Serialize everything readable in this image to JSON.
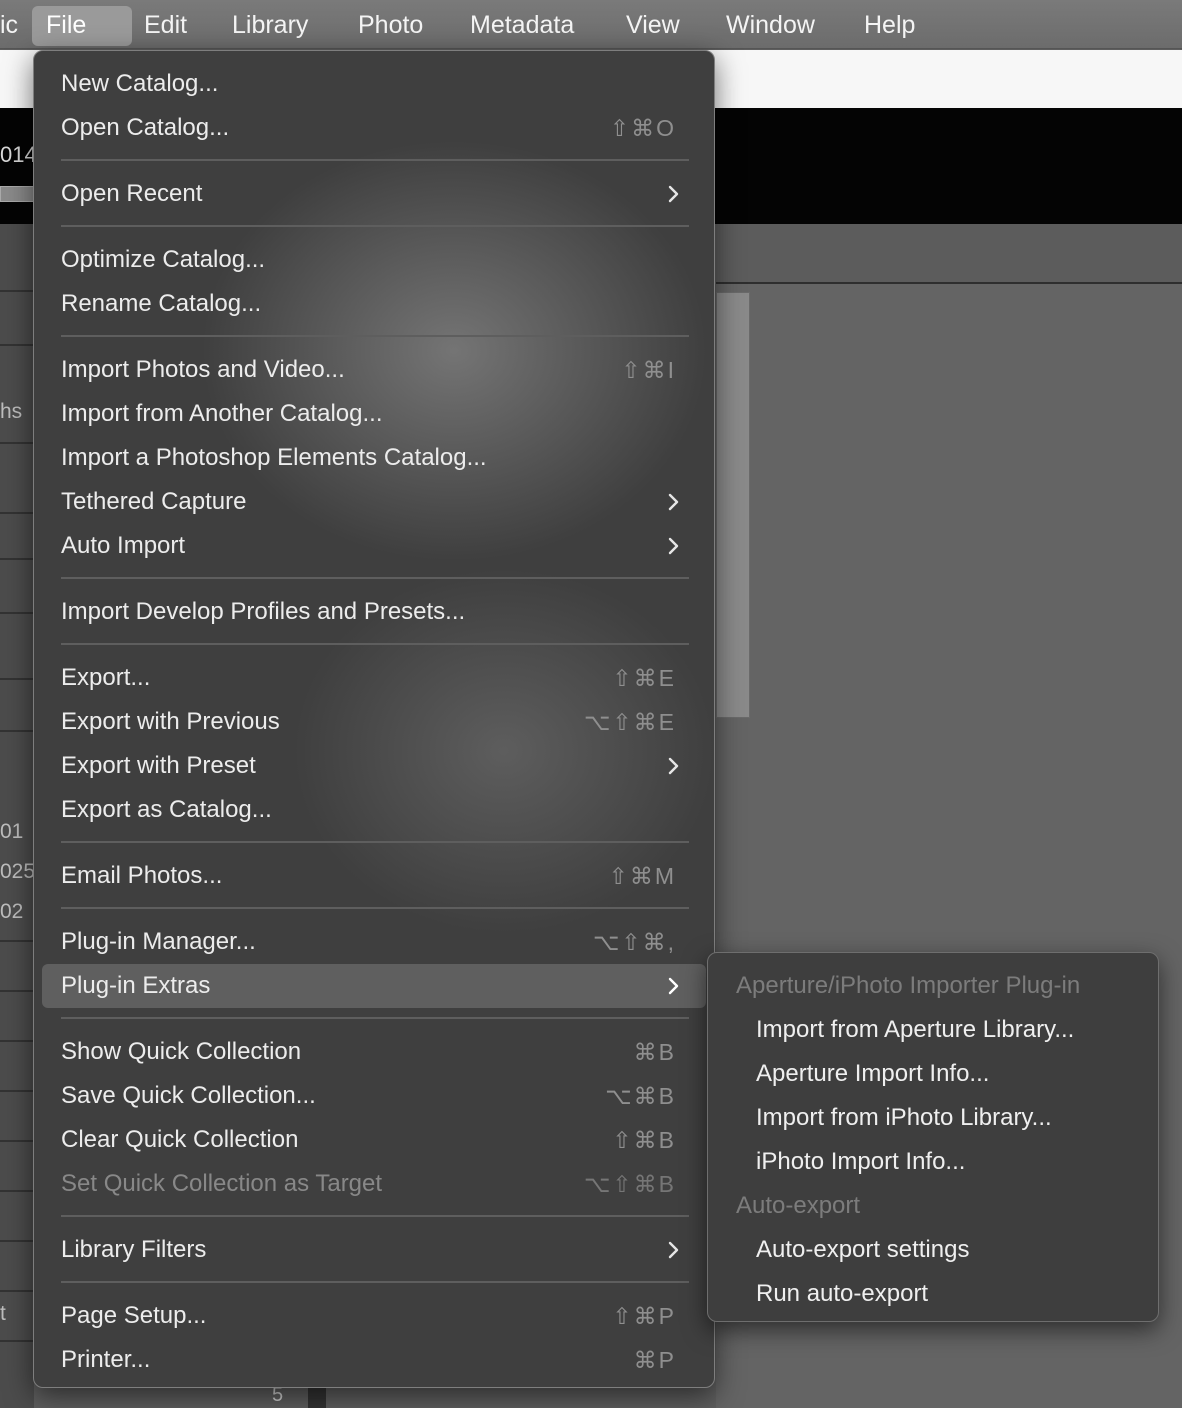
{
  "menubar": {
    "app_fragment": "ic",
    "items": [
      "File",
      "Edit",
      "Library",
      "Photo",
      "Metadata",
      "View",
      "Window",
      "Help"
    ]
  },
  "background": {
    "path_fragment": "014/",
    "left_fragments": [
      "hs",
      "01",
      "025-",
      "02",
      "t",
      "5"
    ]
  },
  "file_menu": {
    "items": [
      {
        "label": "New Catalog...",
        "shortcut": ""
      },
      {
        "label": "Open Catalog...",
        "shortcut": "⇧⌘O"
      },
      {
        "label": "Open Recent",
        "submenu": true
      },
      {
        "label": "Optimize Catalog...",
        "shortcut": ""
      },
      {
        "label": "Rename Catalog...",
        "shortcut": ""
      },
      {
        "label": "Import Photos and Video...",
        "shortcut": "⇧⌘I"
      },
      {
        "label": "Import from Another Catalog...",
        "shortcut": ""
      },
      {
        "label": "Import a Photoshop Elements Catalog...",
        "shortcut": ""
      },
      {
        "label": "Tethered Capture",
        "submenu": true
      },
      {
        "label": "Auto Import",
        "submenu": true
      },
      {
        "label": "Import Develop Profiles and Presets...",
        "shortcut": ""
      },
      {
        "label": "Export...",
        "shortcut": "⇧⌘E"
      },
      {
        "label": "Export with Previous",
        "shortcut": "⌥⇧⌘E"
      },
      {
        "label": "Export with Preset",
        "submenu": true
      },
      {
        "label": "Export as Catalog...",
        "shortcut": ""
      },
      {
        "label": "Email Photos...",
        "shortcut": "⇧⌘M"
      },
      {
        "label": "Plug-in Manager...",
        "shortcut": "⌥⇧⌘,"
      },
      {
        "label": "Plug-in Extras",
        "submenu": true,
        "highlighted": true
      },
      {
        "label": "Show Quick Collection",
        "shortcut": "⌘B"
      },
      {
        "label": "Save Quick Collection...",
        "shortcut": "⌥⌘B"
      },
      {
        "label": "Clear Quick Collection",
        "shortcut": "⇧⌘B"
      },
      {
        "label": "Set Quick Collection as Target",
        "shortcut": "⌥⇧⌘B",
        "disabled": true
      },
      {
        "label": "Library Filters",
        "submenu": true
      },
      {
        "label": "Page Setup...",
        "shortcut": "⇧⌘P"
      },
      {
        "label": "Printer...",
        "shortcut": "⌘P"
      }
    ]
  },
  "plugin_extras_submenu": {
    "sections": [
      {
        "header": "Aperture/iPhoto Importer Plug-in",
        "items": [
          "Import from Aperture Library...",
          "Aperture Import Info...",
          "Import from iPhoto Library...",
          "iPhoto Import Info..."
        ]
      },
      {
        "header": "Auto-export",
        "items": [
          "Auto-export settings",
          "Run auto-export"
        ]
      }
    ]
  },
  "colors": {
    "menu_bg": "#3f3f3f",
    "menubar_bg": "#707070",
    "highlight": "#5a5a5a",
    "disabled_text": "#888888"
  }
}
